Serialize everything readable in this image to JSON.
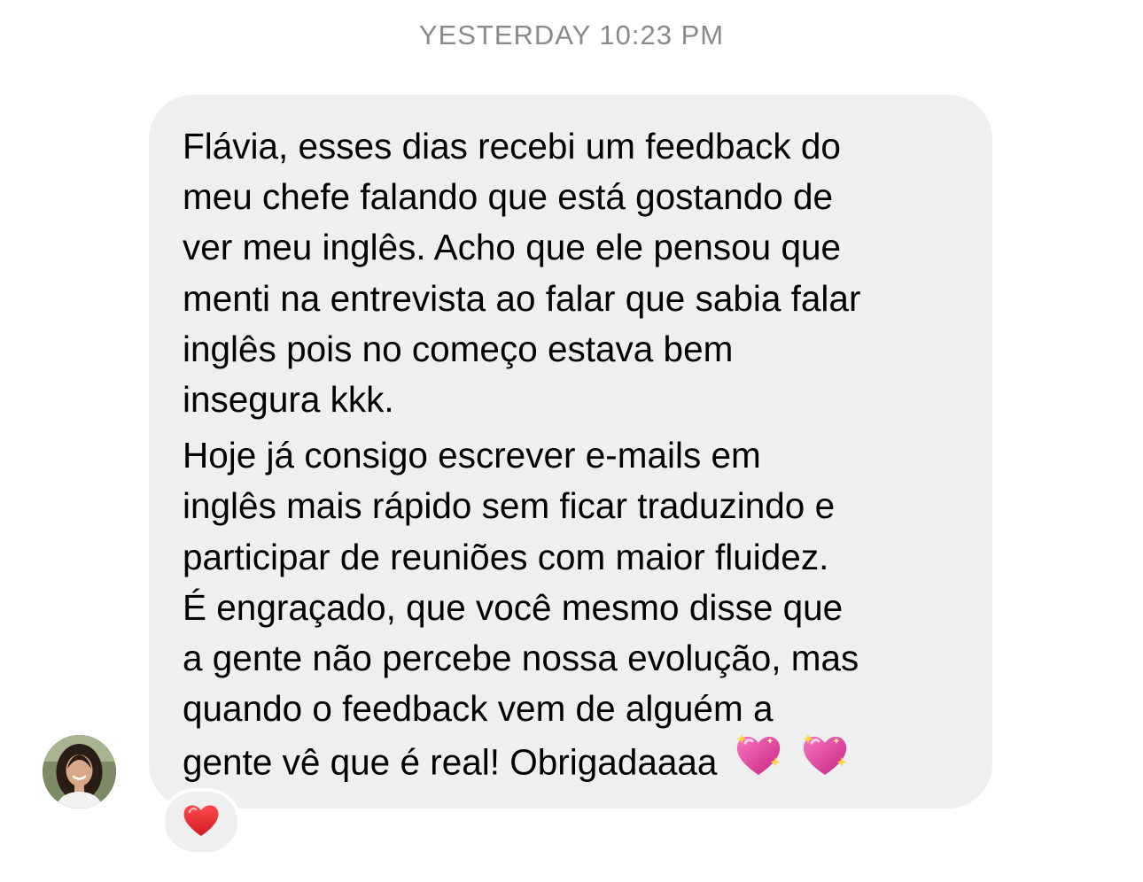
{
  "thread": {
    "timestamp": "YESTERDAY 10:23 PM"
  },
  "message": {
    "lines": [
      "Flávia, esses dias recebi um feedback do",
      "meu chefe falando que está gostando de",
      "ver meu inglês. Acho que ele pensou que",
      "menti na entrevista ao falar que sabia falar",
      "inglês pois no começo estava bem",
      "insegura kkk.",
      "Hoje já consigo escrever e-mails em",
      "inglês mais rápido sem ficar traduzindo e",
      "participar de reuniões com maior fluidez.",
      "É engraçado, que você mesmo disse que",
      "a gente não percebe nossa evolução, mas",
      "quando o feedback vem de alguém a",
      "gente vê que é real! Obrigadaaaa"
    ],
    "trailing_emoji": [
      "sparkling-heart-icon",
      "sparkling-heart-icon"
    ]
  },
  "reaction": {
    "icon": "red-heart-icon",
    "color": "#e0242b"
  },
  "colors": {
    "bubble": "#efefef",
    "timestamp": "#8a8a8e",
    "heart_pink": "#e8459a"
  }
}
